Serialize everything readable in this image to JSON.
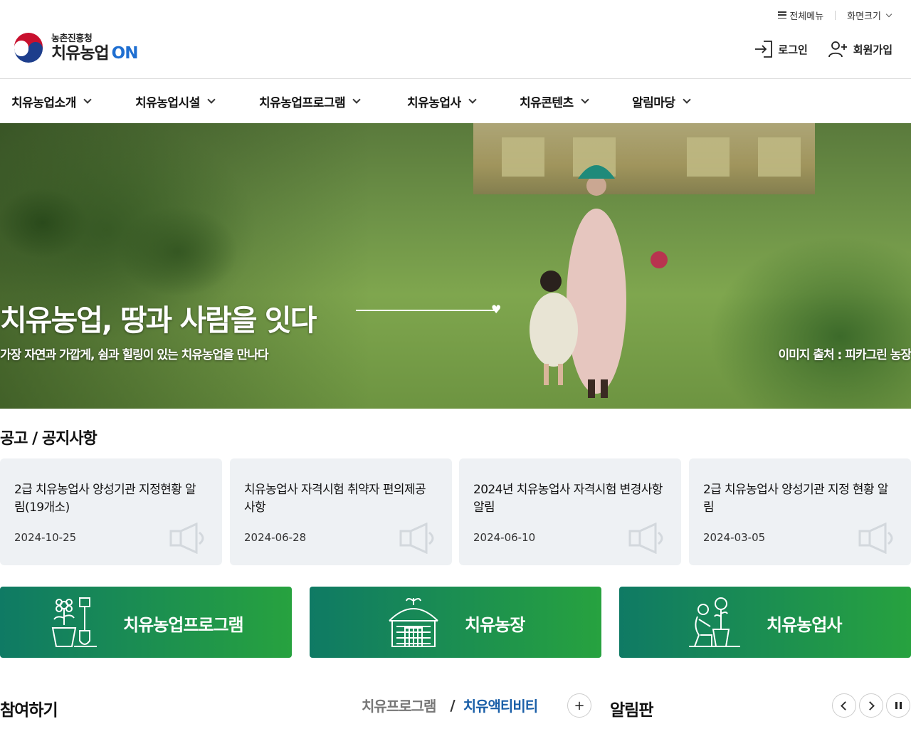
{
  "header": {
    "util": {
      "all_menu": "전체메뉴",
      "font_size": "화면크기"
    },
    "logo": {
      "ministry": "농촌진흥청",
      "main": "치유농업",
      "on": "ON"
    },
    "auth": {
      "login": "로그인",
      "signup": "회원가입"
    }
  },
  "gnb": [
    {
      "label": "치유농업소개"
    },
    {
      "label": "치유농업시설"
    },
    {
      "label": "치유농업프로그램"
    },
    {
      "label": "치유농업사"
    },
    {
      "label": "치유콘텐츠"
    },
    {
      "label": "알림마당"
    }
  ],
  "hero": {
    "title": "치유농업, 땅과 사람을 잇다",
    "subtitle": "가장 자연과 가깝게, 쉼과 힐링이 있는 치유농업을 만나다",
    "credit": "이미지 출처 : 피카그린 농장"
  },
  "notices": {
    "title": "공고 / 공지사항",
    "items": [
      {
        "title": "2급 치유농업사 양성기관 지정현황 알림(19개소)",
        "date": "2024-10-25"
      },
      {
        "title": "치유농업사 자격시험 취약자 편의제공 사항",
        "date": "2024-06-28"
      },
      {
        "title": "2024년 치유농업사 자격시험 변경사항 알림",
        "date": "2024-06-10"
      },
      {
        "title": "2급 치유농업사 양성기관 지정 현황 알림",
        "date": "2024-03-05"
      }
    ]
  },
  "quick": [
    {
      "label": "치유농업프로그램",
      "icon": "garden-tools-icon"
    },
    {
      "label": "치유농장",
      "icon": "greenhouse-icon"
    },
    {
      "label": "치유농업사",
      "icon": "gardener-icon"
    }
  ],
  "bottom": {
    "participate": "참여하기",
    "tab_program": "치유프로그램",
    "tab_sep": "/",
    "tab_activity": "치유액티비티",
    "more": "+",
    "board": "알림판"
  },
  "colors": {
    "accent_blue": "#1f6fd1",
    "quick_gradient_start": "#0f7a64",
    "quick_gradient_end": "#27a23f",
    "active_tab": "#1a5fa8"
  }
}
